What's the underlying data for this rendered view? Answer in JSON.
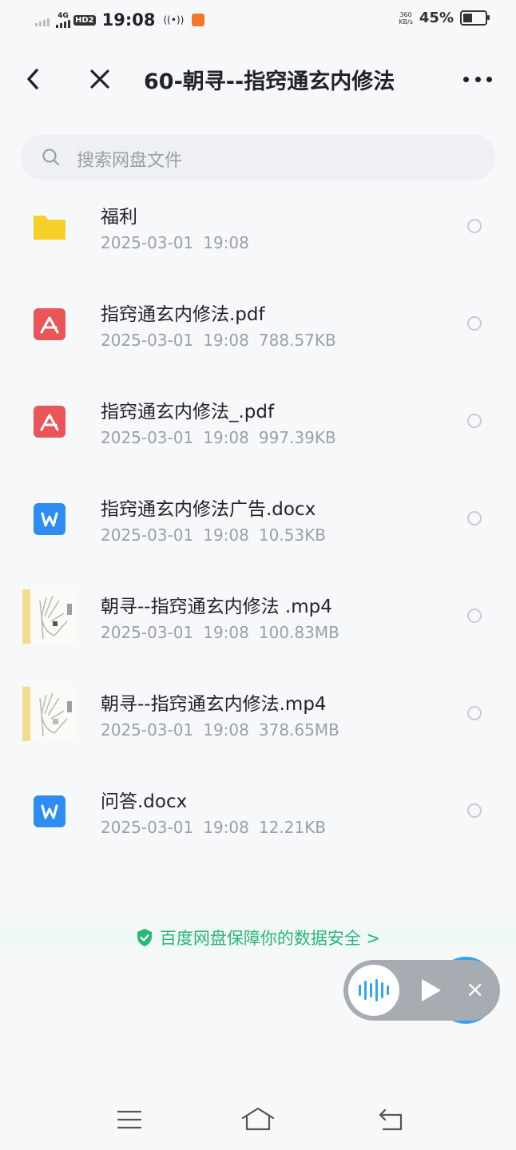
{
  "status_bar": {
    "network": "4G",
    "hd": "HD2",
    "time": "19:08",
    "speed_value": "360",
    "speed_unit": "KB/s",
    "battery": "45%",
    "battery_level": 0.45
  },
  "header": {
    "title": "60-朝寻--指窍通玄内修法"
  },
  "search": {
    "placeholder": "搜索网盘文件"
  },
  "files": [
    {
      "name": "福利",
      "date": "2025-03-01",
      "time": "19:08",
      "size": "",
      "type": "folder"
    },
    {
      "name": "指窍通玄内修法.pdf",
      "date": "2025-03-01",
      "time": "19:08",
      "size": "788.57KB",
      "type": "pdf"
    },
    {
      "name": "指窍通玄内修法_.pdf",
      "date": "2025-03-01",
      "time": "19:08",
      "size": "997.39KB",
      "type": "pdf"
    },
    {
      "name": "指窍通玄内修法广告.docx",
      "date": "2025-03-01",
      "time": "19:08",
      "size": "10.53KB",
      "type": "docx"
    },
    {
      "name": "朝寻--指窍通玄内修法 .mp4",
      "date": "2025-03-01",
      "time": "19:08",
      "size": "100.83MB",
      "type": "video"
    },
    {
      "name": "朝寻--指窍通玄内修法.mp4",
      "date": "2025-03-01",
      "time": "19:08",
      "size": "378.65MB",
      "type": "video"
    },
    {
      "name": "问答.docx",
      "date": "2025-03-01",
      "time": "19:08",
      "size": "12.21KB",
      "type": "docx"
    }
  ],
  "footer": {
    "safety_text": "百度网盘保障你的数据安全 >"
  },
  "colors": {
    "folder": "#f7cf2a",
    "pdf": "#e8565a",
    "docx": "#2f8cf0",
    "safety": "#2db37c",
    "player_accent": "#3aa2e8"
  },
  "icons": {
    "back": "chevron-left-icon",
    "close": "close-icon",
    "more": "more-horizontal-icon",
    "search": "search-icon",
    "safety": "shield-check-icon",
    "nav_menu": "menu-icon",
    "nav_home": "home-icon",
    "nav_back": "return-icon"
  }
}
